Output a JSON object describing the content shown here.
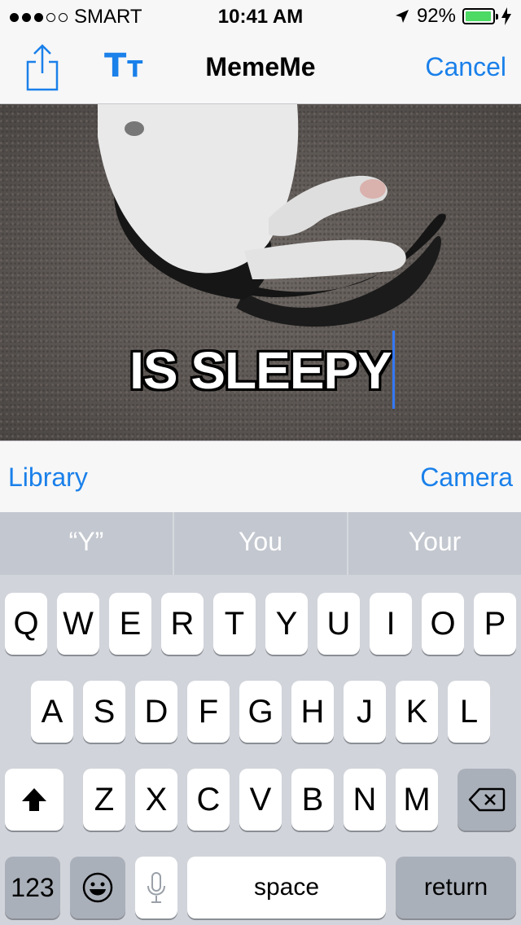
{
  "status_bar": {
    "carrier": "SMART",
    "time": "10:41 AM",
    "battery": "92%",
    "battery_level": 0.92
  },
  "nav": {
    "title": "MemeMe",
    "cancel": "Cancel",
    "font_button_big": "T",
    "font_button_small": "T"
  },
  "meme": {
    "bottom_text": "IS SLEEPY"
  },
  "toolbar": {
    "library": "Library",
    "camera": "Camera"
  },
  "suggestions": [
    "“Y”",
    "You",
    "Your"
  ],
  "keyboard": {
    "row1": [
      "Q",
      "W",
      "E",
      "R",
      "T",
      "Y",
      "U",
      "I",
      "O",
      "P"
    ],
    "row2": [
      "A",
      "S",
      "D",
      "F",
      "G",
      "H",
      "J",
      "K",
      "L"
    ],
    "row3": [
      "Z",
      "X",
      "C",
      "V",
      "B",
      "N",
      "M"
    ],
    "numbers": "123",
    "space": "space",
    "return": "return"
  },
  "colors": {
    "accent": "#1a80ea",
    "caret": "#3478f6",
    "battery": "#4cd964"
  }
}
